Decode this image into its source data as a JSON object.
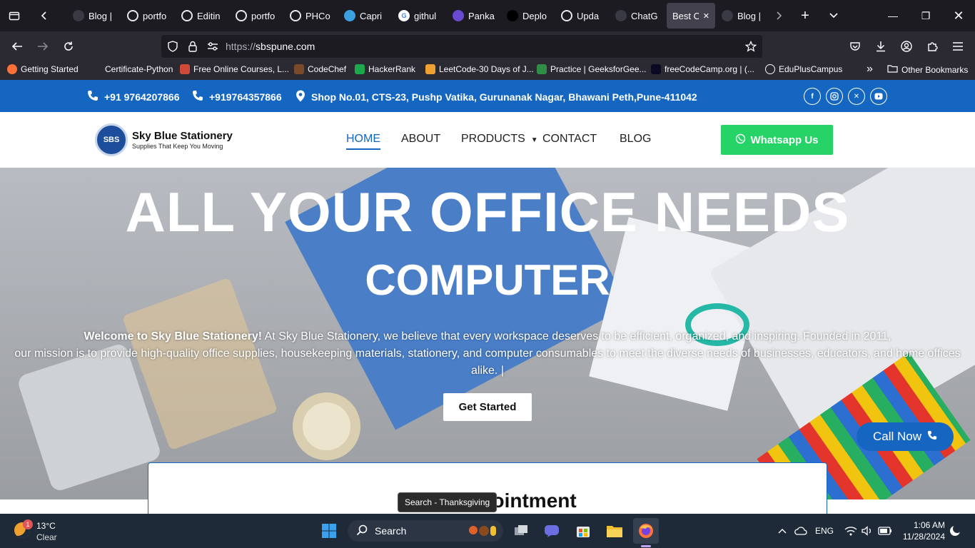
{
  "browser": {
    "tabs": [
      {
        "label": "Blog |",
        "icon": "blog-icon"
      },
      {
        "label": "portfo",
        "icon": "github-icon"
      },
      {
        "label": "Editin",
        "icon": "github-icon"
      },
      {
        "label": "portfo",
        "icon": "github-icon"
      },
      {
        "label": "PHCo",
        "icon": "github-icon"
      },
      {
        "label": "Capri",
        "icon": "capri-icon"
      },
      {
        "label": "githul",
        "icon": "google-icon"
      },
      {
        "label": "Panka",
        "icon": "panka-icon"
      },
      {
        "label": "Deplo",
        "icon": "vercel-icon"
      },
      {
        "label": "Upda",
        "icon": "github-icon"
      },
      {
        "label": "ChatG",
        "icon": "chatgpt-icon"
      },
      {
        "label": "Best Of",
        "icon": "",
        "active": true
      },
      {
        "label": "Blog |",
        "icon": "blog-icon"
      }
    ],
    "url_scheme": "https://",
    "url_host": "sbspune.com",
    "bookmarks": [
      {
        "label": "Getting Started",
        "icon": "firefox-icon"
      },
      {
        "label": "Certificate-Python",
        "icon": "cert-icon"
      },
      {
        "label": "Free Online Courses, L...",
        "icon": "courses-icon"
      },
      {
        "label": "CodeChef",
        "icon": "codechef-icon"
      },
      {
        "label": "HackerRank",
        "icon": "hackerrank-icon"
      },
      {
        "label": "LeetCode-30 Days of J...",
        "icon": "leetcode-icon"
      },
      {
        "label": "Practice | GeeksforGee...",
        "icon": "gfg-icon"
      },
      {
        "label": "freeCodeCamp.org | (...",
        "icon": "fcc-icon"
      },
      {
        "label": "EduPlusCampus",
        "icon": "globe-icon"
      }
    ],
    "other_bookmarks": "Other Bookmarks"
  },
  "site": {
    "phone1": "+91 9764207866",
    "phone2": "+919764357866",
    "address": "Shop No.01, CTS-23, Pushp Vatika, Gurunanak Nagar, Bhawani Peth,Pune-411042",
    "logo_initials": "SBS",
    "brand_name": "Sky Blue Stationery",
    "tagline": "Supplies That Keep You Moving",
    "menu": {
      "home": "HOME",
      "about": "ABOUT",
      "products": "PRODUCTS",
      "contact": "CONTACT",
      "blog": "BLOG"
    },
    "whatsapp_label": "Whatsapp Us",
    "hero": {
      "headline": "ALL YOUR OFFICE NEEDS",
      "subheadline": "COMPUTER",
      "welcome_bold": "Welcome to Sky Blue Stationery!",
      "welcome_text": " At Sky Blue Stationery, we believe that every workspace deserves to be efficient, organized, and inspiring. Founded in 2011,",
      "mission_text": "our mission is to provide high-quality office supplies, housekeeping materials, stationery, and computer consumables to meet the diverse needs of businesses, educators, and home offices alike.",
      "cta": "Get Started"
    },
    "call_now": "Call Now",
    "appointment_title": "Book Appointment"
  },
  "tooltip": "Search - Thanksgiving",
  "taskbar": {
    "weather_temp": "13°C",
    "weather_desc": "Clear",
    "weather_badge": "1",
    "search_label": "Search",
    "language": "ENG",
    "time": "1:06 AM",
    "date": "11/28/2024"
  },
  "colors": {
    "brand_blue": "#1466c0",
    "whatsapp_green": "#25d366"
  }
}
